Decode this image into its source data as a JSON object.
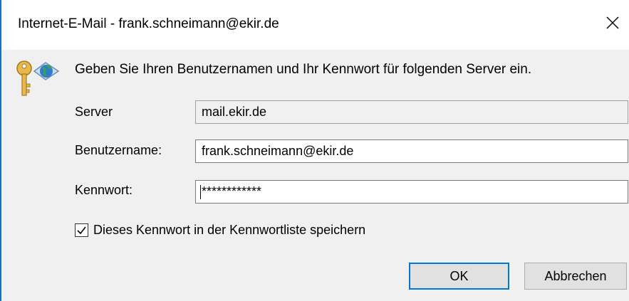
{
  "window": {
    "title": "Internet-E-Mail - frank.schneimann@ekir.de",
    "accent": "#0078d7"
  },
  "icons": {
    "close": "close-icon",
    "prompt": "key-globe-icon",
    "checkbox": "checkmark-icon"
  },
  "prompt": {
    "text": "Geben Sie Ihren Benutzernamen und Ihr Kennwort für folgenden Server ein."
  },
  "form": {
    "server_label": "Server",
    "server_value": "mail.ekir.de",
    "username_label": "Benutzername:",
    "username_value": "frank.schneimann@ekir.de",
    "password_label": "Kennwort:",
    "password_value": "************",
    "remember_label": "Dieses Kennwort in der Kennwortliste speichern",
    "remember_checked": true
  },
  "buttons": {
    "ok_label": "OK",
    "cancel_label": "Abbrechen"
  }
}
